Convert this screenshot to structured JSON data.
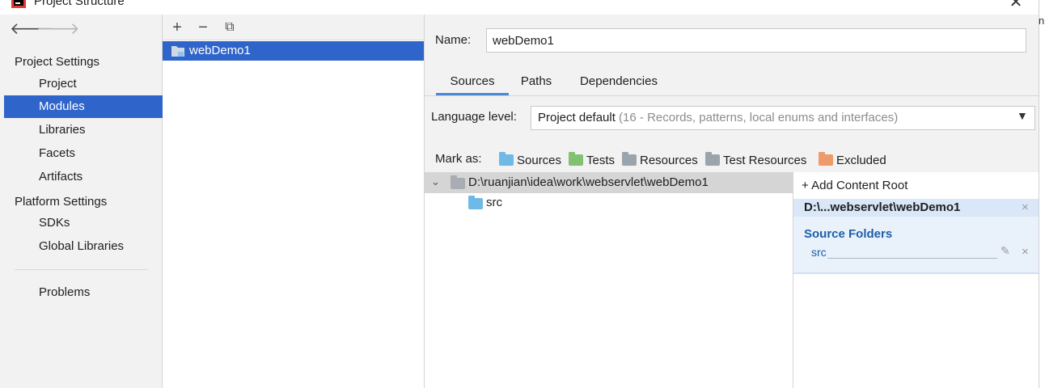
{
  "window": {
    "title": "Project Structure",
    "close_glyph": "✕",
    "edge_text": "n."
  },
  "nav": {
    "back_glyph": "🡐",
    "forward_glyph": "🡒",
    "sections": [
      {
        "label": "Project Settings",
        "items": [
          "Project",
          "Modules",
          "Libraries",
          "Facets",
          "Artifacts"
        ]
      },
      {
        "label": "Platform Settings",
        "items": [
          "SDKs",
          "Global Libraries"
        ]
      }
    ],
    "problems": "Problems",
    "selected": "Modules"
  },
  "modules": {
    "toolbar": {
      "add": "+",
      "remove": "−",
      "copy": "⧉"
    },
    "items": [
      "webDemo1"
    ]
  },
  "details": {
    "name_label": "Name:",
    "name_value": "webDemo1",
    "tabs": [
      "Sources",
      "Paths",
      "Dependencies"
    ],
    "active_tab": "Sources",
    "language_label": "Language level:",
    "language_value": "Project default",
    "language_hint": " (16 - Records, patterns, local enums and interfaces)",
    "mark_as_label": "Mark as:",
    "mark_buttons": [
      {
        "label": "Sources",
        "color": "#6fb9e6"
      },
      {
        "label": "Tests",
        "color": "#82c172"
      },
      {
        "label": "Resources",
        "color": "#9aa4ad"
      },
      {
        "label": "Test Resources",
        "color": "#9aa4ad"
      },
      {
        "label": "Excluded",
        "color": "#ef9a6a"
      }
    ]
  },
  "tree": {
    "root": "D:\\ruanjian\\idea\\work\\webservlet\\webDemo1",
    "children": [
      "src"
    ]
  },
  "content_roots": {
    "add_label": "Add Content Root",
    "add_glyph": "+",
    "root_path": "D:\\...webservlet\\webDemo1",
    "source_folders_title": "Source Folders",
    "source_folders": [
      "src"
    ],
    "edit_glyph": "✎",
    "remove_glyph": "×"
  }
}
